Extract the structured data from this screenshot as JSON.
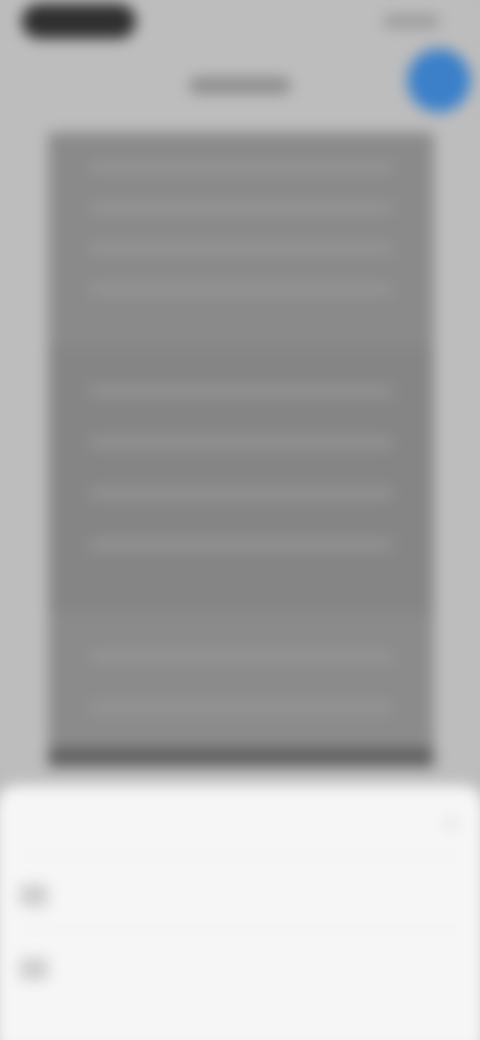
{
  "status_bar": {
    "time": "",
    "indicators": ""
  },
  "nav": {
    "title": ""
  },
  "fab": {
    "color": "#3b80c9",
    "icon": "circle-action-icon"
  },
  "preview": {
    "kind": "blurred document preview"
  },
  "sheet": {
    "title": "",
    "close_icon": "close-icon",
    "items": [
      {
        "label": "",
        "icon": "document-icon"
      },
      {
        "label": "",
        "icon": "folder-icon"
      }
    ]
  }
}
